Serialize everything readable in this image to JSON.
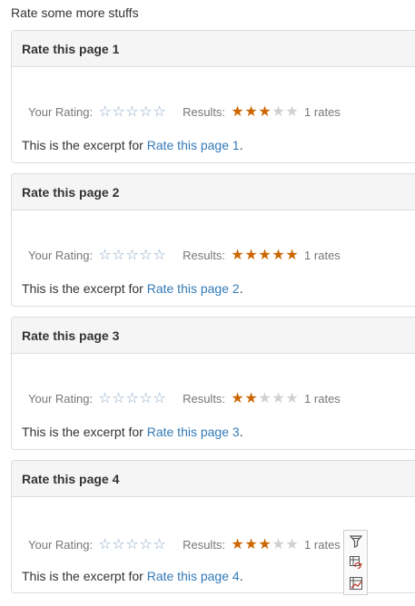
{
  "heading": "Rate some more stuffs",
  "labels": {
    "your_rating": "Your Rating:",
    "results": "Results:",
    "rates_suffix": "rates",
    "excerpt_prefix": "This is the excerpt for",
    "excerpt_suffix": "."
  },
  "colors": {
    "star_filled": "#cc6600",
    "star_blank": "#d0d0d0",
    "star_outline": "#8aa6c4",
    "link": "#337ab7"
  },
  "cards": [
    {
      "title": "Rate this page 1",
      "result_stars": 3,
      "rate_count": "1",
      "link_text": "Rate this page 1"
    },
    {
      "title": "Rate this page 2",
      "result_stars": 5,
      "rate_count": "1",
      "link_text": "Rate this page 2"
    },
    {
      "title": "Rate this page 3",
      "result_stars": 2,
      "rate_count": "1",
      "link_text": "Rate this page 3"
    },
    {
      "title": "Rate this page 4",
      "result_stars": 3,
      "rate_count": "1",
      "link_text": "Rate this page 4"
    }
  ],
  "toolbar": {
    "icons": [
      "filter-icon",
      "table-refresh-icon",
      "chart-icon"
    ]
  }
}
